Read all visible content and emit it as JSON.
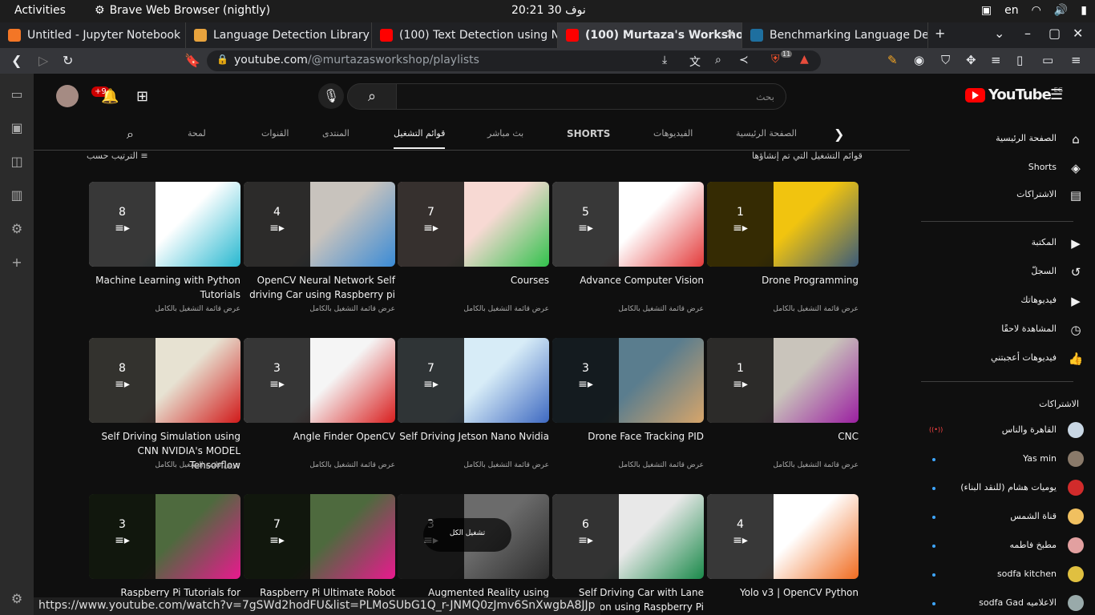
{
  "system": {
    "activities": "Activities",
    "app_name": "Brave Web Browser (nightly)",
    "clock": "نوف 30  20:21",
    "lang": "en"
  },
  "tabs": [
    {
      "label": "Untitled - Jupyter Notebook",
      "color": "#f37626"
    },
    {
      "label": "Language Detection Library",
      "color": "#e8a33d"
    },
    {
      "label": "(100) Text Detection using N",
      "color": "#ff0000"
    },
    {
      "label": "(100) Murtaza's Worksho",
      "color": "#ff0000",
      "active": true
    },
    {
      "label": "Benchmarking Language De",
      "color": "#1e6f9f"
    }
  ],
  "address": {
    "host": "youtube.com",
    "path": "/@murtazasworkshop/playlists",
    "shield_count": "11"
  },
  "youtube": {
    "notif_badge": "+9",
    "search_placeholder": "بحث",
    "logo": "YouTube",
    "country": "EG",
    "channel_tabs": [
      "لمحة",
      "القنوات",
      "المنتدى",
      "قوائم التشغيل",
      "بث مباشر",
      "SHORTS",
      "الفيديوهات",
      "الصفحة الرئيسية"
    ],
    "section_title": "قوائم التشغيل التي تم إنشاؤها",
    "sort_label": "الترتيب حسب",
    "view_full": "عرض قائمة التشغيل بالكامل",
    "play_all": "تشغيل الكل",
    "playlists": [
      {
        "title": "Drone Programming",
        "count": "1",
        "colors": [
          "#f1c40f",
          "#3b5b7a"
        ]
      },
      {
        "title": "Advance Computer Vision",
        "count": "5",
        "colors": [
          "#ffffff",
          "#e33b3b"
        ]
      },
      {
        "title": "Courses",
        "count": "7",
        "colors": [
          "#f7d9d3",
          "#32c24d"
        ]
      },
      {
        "title": "OpenCV Neural Network Self driving Car using Raspberry pi",
        "count": "4",
        "colors": [
          "#c8c3bd",
          "#3a8bd6"
        ]
      },
      {
        "title": "Machine Learning with Python Tutorials",
        "count": "8",
        "colors": [
          "#ffffff",
          "#28b8d0"
        ]
      },
      {
        "title": "CNC",
        "count": "1",
        "colors": [
          "#c9c4bb",
          "#9b1fa1"
        ]
      },
      {
        "title": "Drone Face Tracking PID",
        "count": "3",
        "colors": [
          "#5a7d8e",
          "#d7a56a"
        ]
      },
      {
        "title": "Self Driving Jetson Nano Nvidia",
        "count": "7",
        "colors": [
          "#d7ecf7",
          "#3e69c1"
        ]
      },
      {
        "title": "Angle Finder OpenCV",
        "count": "3",
        "colors": [
          "#f5f5f5",
          "#d91f1f"
        ]
      },
      {
        "title": "Self Driving Simulation using CNN NVIDIA's MODEL Tensorflow",
        "count": "8",
        "colors": [
          "#e7e2d2",
          "#d11a1a"
        ]
      },
      {
        "title": "Yolo v3 | OpenCV Python",
        "count": "4",
        "colors": [
          "#ffffff",
          "#f06b1f"
        ]
      },
      {
        "title": "Self Driving Car with Lane Detection using Raspberry Pi",
        "count": "6",
        "colors": [
          "#e8e8e8",
          "#1a8a4a"
        ]
      },
      {
        "title": "Augmented Reality using",
        "count": "3",
        "colors": [
          "#6b6b6b",
          "#2c2c2c"
        ]
      },
      {
        "title": "Raspberry Pi Ultimate Robot",
        "count": "7",
        "colors": [
          "#4e6a3e",
          "#e9198e"
        ]
      },
      {
        "title": "Raspberry Pi Tutorials for",
        "count": "3",
        "colors": [
          "#4e6a3e",
          "#e9198e"
        ]
      }
    ],
    "nav": [
      {
        "label": "الصفحة الرئيسية",
        "icon": "⌂"
      },
      {
        "label": "Shorts",
        "icon": "◈"
      },
      {
        "label": "الاشتراكات",
        "icon": "▤"
      },
      {
        "label": "المكتبة",
        "icon": "▶"
      },
      {
        "label": "السجلّ",
        "icon": "↺"
      },
      {
        "label": "فيديوهاتك",
        "icon": "▶"
      },
      {
        "label": "المشاهدة لاحقًا",
        "icon": "◷"
      },
      {
        "label": "فيديوهات أعجبتني",
        "icon": "👍"
      }
    ],
    "subs_title": "الاشتراكات",
    "subs": [
      {
        "name": "القاهرة والناس",
        "color": "#c9d7e4",
        "live": true
      },
      {
        "name": "Yas min",
        "color": "#8a7a6a"
      },
      {
        "name": "يوميات هشام (للنقد البناء)",
        "color": "#d12b2b"
      },
      {
        "name": "قناة الشمس",
        "color": "#f0c060"
      },
      {
        "name": "مطبخ فاطمه",
        "color": "#e2a0a0"
      },
      {
        "name": "sodfa kitchen",
        "color": "#e0c040"
      },
      {
        "name": "sodfa Gad الاعلاميه",
        "color": "#9aa"
      }
    ]
  },
  "status_url": "https://www.youtube.com/watch?v=7gSWd2hodFU&list=PLMoSUbG1Q_r-JNMQ0zJmv6SnXwgbA8JJp"
}
